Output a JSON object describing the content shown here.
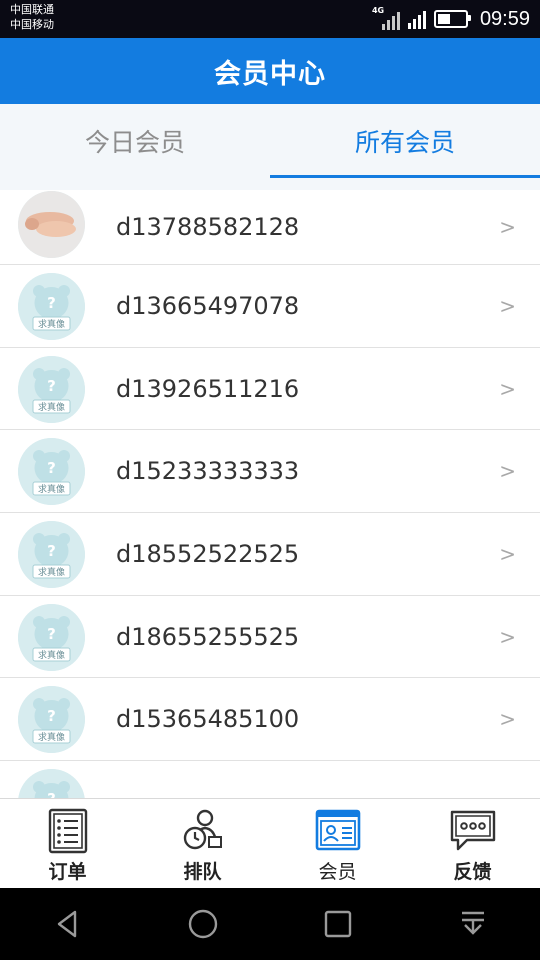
{
  "status_bar": {
    "carrier1": "中国联通",
    "carrier2": "中国移动",
    "network": "4G",
    "time": "09:59",
    "battery_level": 0.45
  },
  "header": {
    "title": "会员中心"
  },
  "tabs": [
    {
      "label": "今日会员",
      "active": false
    },
    {
      "label": "所有会员",
      "active": true
    }
  ],
  "members": [
    {
      "id": "d13788582128",
      "avatar": "photo"
    },
    {
      "id": "d13665497078",
      "avatar": "default"
    },
    {
      "id": "d13926511216",
      "avatar": "default"
    },
    {
      "id": "d15233333333",
      "avatar": "default"
    },
    {
      "id": "d18552522525",
      "avatar": "default"
    },
    {
      "id": "d18655255525",
      "avatar": "default"
    },
    {
      "id": "d15365485100",
      "avatar": "default"
    },
    {
      "id": "",
      "avatar": "default"
    }
  ],
  "avatar_placeholder_text": "求真像",
  "chevron": ">",
  "bottom_nav": [
    {
      "label": "订单",
      "icon": "order-list-icon",
      "active": false
    },
    {
      "label": "排队",
      "icon": "queue-icon",
      "active": false
    },
    {
      "label": "会员",
      "icon": "member-card-icon",
      "active": true
    },
    {
      "label": "反馈",
      "icon": "feedback-icon",
      "active": false
    }
  ],
  "colors": {
    "primary": "#137ce0",
    "tab_bg": "#f3f7fa",
    "avatar_bg": "#d7ecef"
  }
}
